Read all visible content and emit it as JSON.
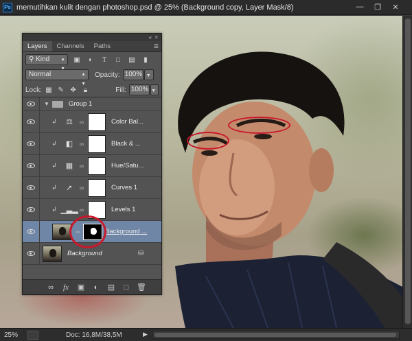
{
  "window": {
    "app_icon": "Ps",
    "title": "memutihkan kulit dengan photoshop.psd @ 25% (Background copy, Layer Mask/8)",
    "controls": [
      "minimize-icon",
      "restore-icon",
      "close-icon"
    ]
  },
  "layers_panel": {
    "tabs": [
      "Layers",
      "Channels",
      "Paths"
    ],
    "filter": {
      "label": "Kind"
    },
    "blend_mode": "Normal",
    "opacity_label": "Opacity:",
    "opacity_value": "100%",
    "lock_label": "Lock:",
    "fill_label": "Fill:",
    "fill_value": "100%",
    "layers": [
      {
        "name": "Group 1",
        "kind": "group"
      },
      {
        "name": "Color Bal...",
        "kind": "adjustment",
        "icon": "scale-icon"
      },
      {
        "name": "Black & ...",
        "kind": "adjustment",
        "icon": "black-white-icon"
      },
      {
        "name": "Hue/Satu...",
        "kind": "adjustment",
        "icon": "hue-saturation-icon"
      },
      {
        "name": "Curves 1",
        "kind": "adjustment",
        "icon": "curves-icon"
      },
      {
        "name": "Levels 1",
        "kind": "adjustment",
        "icon": "levels-icon"
      },
      {
        "name": "Background ...",
        "kind": "masked",
        "selected": true
      },
      {
        "name": "Background",
        "kind": "background",
        "locked": true
      }
    ]
  },
  "status_bar": {
    "zoom": "25%",
    "doc_info": "Doc: 16,8M/38,5M"
  },
  "colors": {
    "annotation": "#c8182c",
    "selection": "#6f86a6"
  }
}
